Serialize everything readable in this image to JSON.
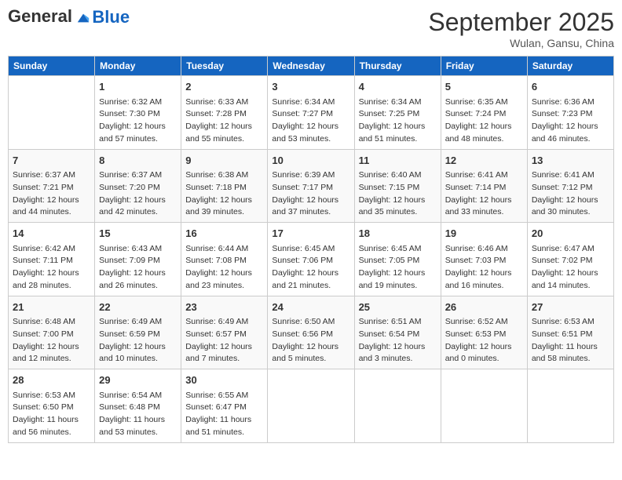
{
  "header": {
    "logo_general": "General",
    "logo_blue": "Blue",
    "month_title": "September 2025",
    "subtitle": "Wulan, Gansu, China"
  },
  "days_of_week": [
    "Sunday",
    "Monday",
    "Tuesday",
    "Wednesday",
    "Thursday",
    "Friday",
    "Saturday"
  ],
  "weeks": [
    [
      {
        "day": "",
        "detail": ""
      },
      {
        "day": "1",
        "detail": "Sunrise: 6:32 AM\nSunset: 7:30 PM\nDaylight: 12 hours\nand 57 minutes."
      },
      {
        "day": "2",
        "detail": "Sunrise: 6:33 AM\nSunset: 7:28 PM\nDaylight: 12 hours\nand 55 minutes."
      },
      {
        "day": "3",
        "detail": "Sunrise: 6:34 AM\nSunset: 7:27 PM\nDaylight: 12 hours\nand 53 minutes."
      },
      {
        "day": "4",
        "detail": "Sunrise: 6:34 AM\nSunset: 7:25 PM\nDaylight: 12 hours\nand 51 minutes."
      },
      {
        "day": "5",
        "detail": "Sunrise: 6:35 AM\nSunset: 7:24 PM\nDaylight: 12 hours\nand 48 minutes."
      },
      {
        "day": "6",
        "detail": "Sunrise: 6:36 AM\nSunset: 7:23 PM\nDaylight: 12 hours\nand 46 minutes."
      }
    ],
    [
      {
        "day": "7",
        "detail": "Sunrise: 6:37 AM\nSunset: 7:21 PM\nDaylight: 12 hours\nand 44 minutes."
      },
      {
        "day": "8",
        "detail": "Sunrise: 6:37 AM\nSunset: 7:20 PM\nDaylight: 12 hours\nand 42 minutes."
      },
      {
        "day": "9",
        "detail": "Sunrise: 6:38 AM\nSunset: 7:18 PM\nDaylight: 12 hours\nand 39 minutes."
      },
      {
        "day": "10",
        "detail": "Sunrise: 6:39 AM\nSunset: 7:17 PM\nDaylight: 12 hours\nand 37 minutes."
      },
      {
        "day": "11",
        "detail": "Sunrise: 6:40 AM\nSunset: 7:15 PM\nDaylight: 12 hours\nand 35 minutes."
      },
      {
        "day": "12",
        "detail": "Sunrise: 6:41 AM\nSunset: 7:14 PM\nDaylight: 12 hours\nand 33 minutes."
      },
      {
        "day": "13",
        "detail": "Sunrise: 6:41 AM\nSunset: 7:12 PM\nDaylight: 12 hours\nand 30 minutes."
      }
    ],
    [
      {
        "day": "14",
        "detail": "Sunrise: 6:42 AM\nSunset: 7:11 PM\nDaylight: 12 hours\nand 28 minutes."
      },
      {
        "day": "15",
        "detail": "Sunrise: 6:43 AM\nSunset: 7:09 PM\nDaylight: 12 hours\nand 26 minutes."
      },
      {
        "day": "16",
        "detail": "Sunrise: 6:44 AM\nSunset: 7:08 PM\nDaylight: 12 hours\nand 23 minutes."
      },
      {
        "day": "17",
        "detail": "Sunrise: 6:45 AM\nSunset: 7:06 PM\nDaylight: 12 hours\nand 21 minutes."
      },
      {
        "day": "18",
        "detail": "Sunrise: 6:45 AM\nSunset: 7:05 PM\nDaylight: 12 hours\nand 19 minutes."
      },
      {
        "day": "19",
        "detail": "Sunrise: 6:46 AM\nSunset: 7:03 PM\nDaylight: 12 hours\nand 16 minutes."
      },
      {
        "day": "20",
        "detail": "Sunrise: 6:47 AM\nSunset: 7:02 PM\nDaylight: 12 hours\nand 14 minutes."
      }
    ],
    [
      {
        "day": "21",
        "detail": "Sunrise: 6:48 AM\nSunset: 7:00 PM\nDaylight: 12 hours\nand 12 minutes."
      },
      {
        "day": "22",
        "detail": "Sunrise: 6:49 AM\nSunset: 6:59 PM\nDaylight: 12 hours\nand 10 minutes."
      },
      {
        "day": "23",
        "detail": "Sunrise: 6:49 AM\nSunset: 6:57 PM\nDaylight: 12 hours\nand 7 minutes."
      },
      {
        "day": "24",
        "detail": "Sunrise: 6:50 AM\nSunset: 6:56 PM\nDaylight: 12 hours\nand 5 minutes."
      },
      {
        "day": "25",
        "detail": "Sunrise: 6:51 AM\nSunset: 6:54 PM\nDaylight: 12 hours\nand 3 minutes."
      },
      {
        "day": "26",
        "detail": "Sunrise: 6:52 AM\nSunset: 6:53 PM\nDaylight: 12 hours\nand 0 minutes."
      },
      {
        "day": "27",
        "detail": "Sunrise: 6:53 AM\nSunset: 6:51 PM\nDaylight: 11 hours\nand 58 minutes."
      }
    ],
    [
      {
        "day": "28",
        "detail": "Sunrise: 6:53 AM\nSunset: 6:50 PM\nDaylight: 11 hours\nand 56 minutes."
      },
      {
        "day": "29",
        "detail": "Sunrise: 6:54 AM\nSunset: 6:48 PM\nDaylight: 11 hours\nand 53 minutes."
      },
      {
        "day": "30",
        "detail": "Sunrise: 6:55 AM\nSunset: 6:47 PM\nDaylight: 11 hours\nand 51 minutes."
      },
      {
        "day": "",
        "detail": ""
      },
      {
        "day": "",
        "detail": ""
      },
      {
        "day": "",
        "detail": ""
      },
      {
        "day": "",
        "detail": ""
      }
    ]
  ]
}
